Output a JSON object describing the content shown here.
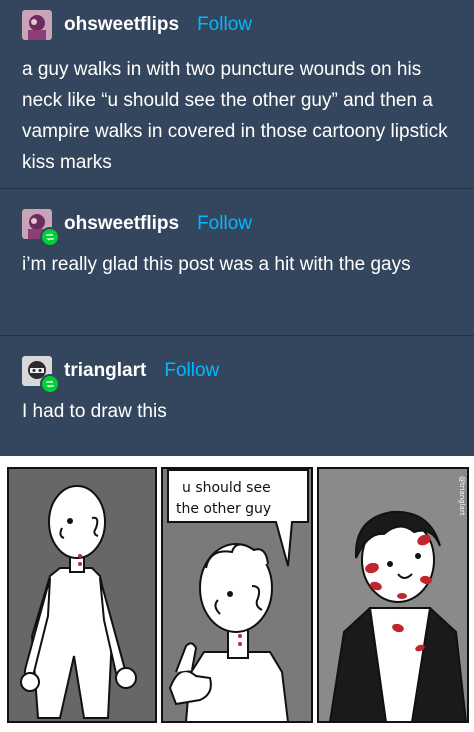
{
  "posts": [
    {
      "username": "ohsweetflips",
      "follow_label": "Follow",
      "text": "a guy walks in with two puncture wounds on his neck like “u should see the other guy” and then a vampire walks in covered in those cartoony lipstick kiss marks",
      "reblog": false
    },
    {
      "username": "ohsweetflips",
      "follow_label": "Follow",
      "text": "i’m really glad this post was a hit with the gays",
      "reblog": true
    },
    {
      "username": "trianglart",
      "follow_label": "Follow",
      "text": "I had to draw this",
      "reblog": true
    }
  ],
  "comic": {
    "speech_line1": "u should see",
    "speech_line2": "the other guy",
    "watermark": "@trianglart"
  },
  "colors": {
    "background": "#34465d",
    "divider": "#22313f",
    "follow": "#00b8ff",
    "reblog_badge": "#00cf35",
    "lipstick": "#c0262c"
  }
}
